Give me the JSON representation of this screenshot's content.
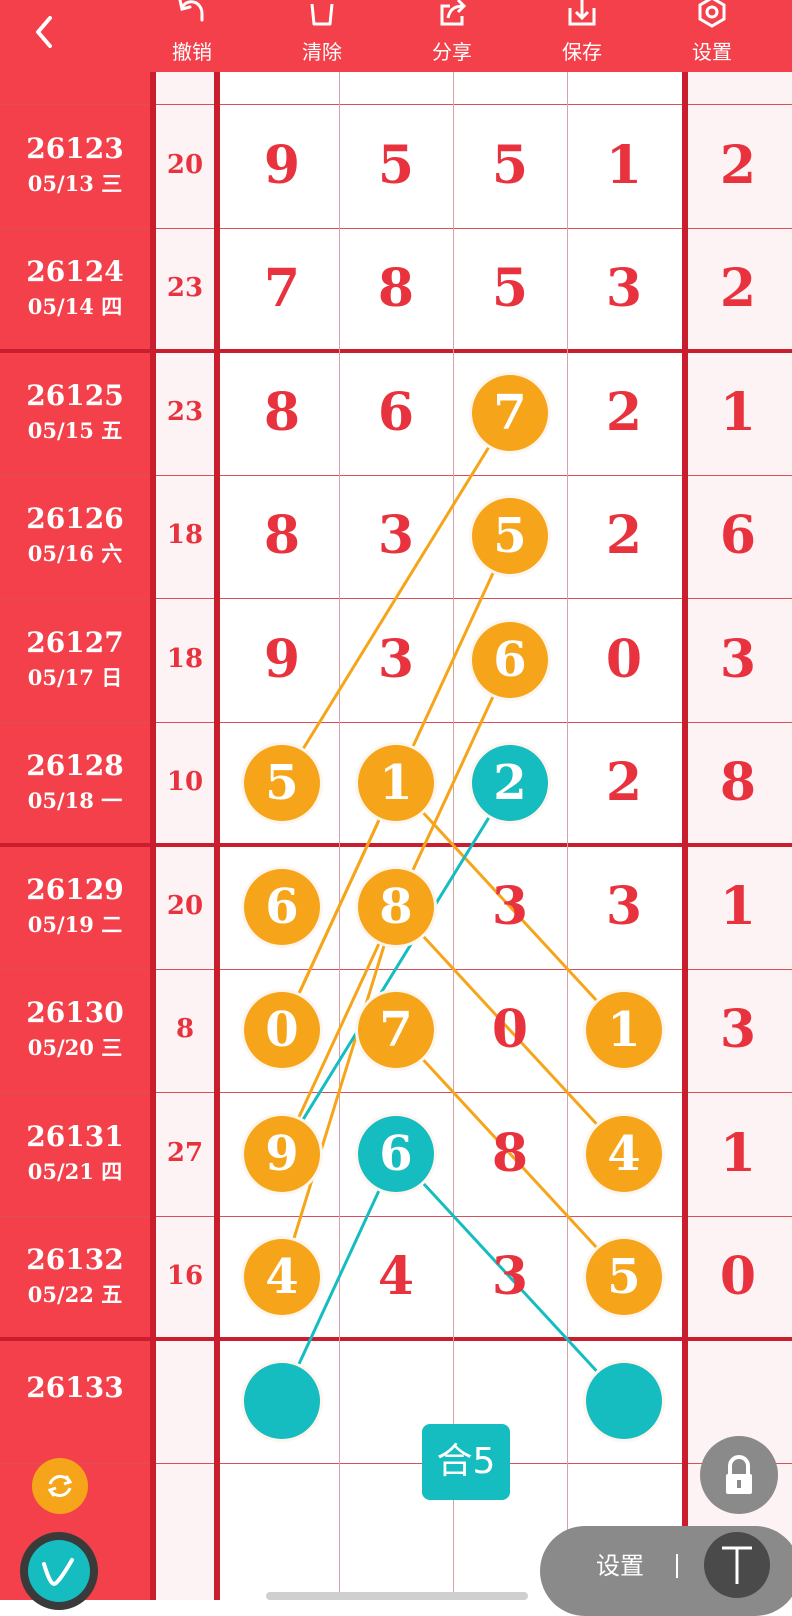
{
  "toolbar": {
    "undo": "撤销",
    "clear": "清除",
    "share": "分享",
    "save": "保存",
    "settings": "设置"
  },
  "rows": [
    {
      "issue": "26123",
      "date": "05/13 三",
      "sum": "20",
      "digits": [
        "9",
        "5",
        "5",
        "1"
      ],
      "span": "2"
    },
    {
      "issue": "26124",
      "date": "05/14 四",
      "sum": "23",
      "digits": [
        "7",
        "8",
        "5",
        "3"
      ],
      "span": "2"
    },
    {
      "issue": "26125",
      "date": "05/15 五",
      "sum": "23",
      "digits": [
        "8",
        "6",
        "7",
        "2"
      ],
      "span": "1"
    },
    {
      "issue": "26126",
      "date": "05/16 六",
      "sum": "18",
      "digits": [
        "8",
        "3",
        "5",
        "2"
      ],
      "span": "6"
    },
    {
      "issue": "26127",
      "date": "05/17 日",
      "sum": "18",
      "digits": [
        "9",
        "3",
        "6",
        "0"
      ],
      "span": "3"
    },
    {
      "issue": "26128",
      "date": "05/18 一",
      "sum": "10",
      "digits": [
        "5",
        "1",
        "2",
        "2"
      ],
      "span": "8"
    },
    {
      "issue": "26129",
      "date": "05/19 二",
      "sum": "20",
      "digits": [
        "6",
        "8",
        "3",
        "3"
      ],
      "span": "1"
    },
    {
      "issue": "26130",
      "date": "05/20 三",
      "sum": "8",
      "digits": [
        "0",
        "7",
        "0",
        "1"
      ],
      "span": "3"
    },
    {
      "issue": "26131",
      "date": "05/21 四",
      "sum": "27",
      "digits": [
        "9",
        "6",
        "8",
        "4"
      ],
      "span": "1"
    },
    {
      "issue": "26132",
      "date": "05/22 五",
      "sum": "16",
      "digits": [
        "4",
        "4",
        "3",
        "5"
      ],
      "span": "0"
    },
    {
      "issue": "26133",
      "date": "",
      "sum": "",
      "digits": [
        "",
        "",
        "",
        ""
      ],
      "span": ""
    }
  ],
  "highlights": [
    {
      "row": 2,
      "col": 2,
      "color": "orange"
    },
    {
      "row": 3,
      "col": 2,
      "color": "orange"
    },
    {
      "row": 4,
      "col": 2,
      "color": "orange"
    },
    {
      "row": 5,
      "col": 0,
      "color": "orange"
    },
    {
      "row": 5,
      "col": 1,
      "color": "orange"
    },
    {
      "row": 5,
      "col": 2,
      "color": "teal"
    },
    {
      "row": 6,
      "col": 0,
      "color": "orange"
    },
    {
      "row": 6,
      "col": 1,
      "color": "orange"
    },
    {
      "row": 7,
      "col": 0,
      "color": "orange"
    },
    {
      "row": 7,
      "col": 1,
      "color": "orange"
    },
    {
      "row": 7,
      "col": 3,
      "color": "orange"
    },
    {
      "row": 8,
      "col": 0,
      "color": "orange"
    },
    {
      "row": 8,
      "col": 1,
      "color": "teal"
    },
    {
      "row": 8,
      "col": 3,
      "color": "orange"
    },
    {
      "row": 9,
      "col": 0,
      "color": "orange"
    },
    {
      "row": 9,
      "col": 3,
      "color": "orange"
    },
    {
      "row": 10,
      "col": 0,
      "color": "teal"
    },
    {
      "row": 10,
      "col": 3,
      "color": "teal"
    }
  ],
  "links": [
    {
      "from": [
        2,
        2
      ],
      "to": [
        5,
        0
      ],
      "color": "orange"
    },
    {
      "from": [
        3,
        2
      ],
      "to": [
        7,
        0
      ],
      "color": "orange"
    },
    {
      "from": [
        4,
        2
      ],
      "to": [
        8,
        0
      ],
      "color": "orange"
    },
    {
      "from": [
        5,
        1
      ],
      "to": [
        7,
        0
      ],
      "color": "orange"
    },
    {
      "from": [
        5,
        1
      ],
      "to": [
        7,
        3
      ],
      "color": "orange"
    },
    {
      "from": [
        6,
        1
      ],
      "to": [
        8,
        3
      ],
      "color": "orange"
    },
    {
      "from": [
        6,
        1
      ],
      "to": [
        9,
        0
      ],
      "color": "orange"
    },
    {
      "from": [
        7,
        1
      ],
      "to": [
        9,
        3
      ],
      "color": "orange"
    },
    {
      "from": [
        5,
        2
      ],
      "to": [
        8,
        0
      ],
      "color": "teal"
    },
    {
      "from": [
        8,
        1
      ],
      "to": [
        10,
        0
      ],
      "color": "teal"
    },
    {
      "from": [
        8,
        1
      ],
      "to": [
        10,
        3
      ],
      "color": "teal"
    }
  ],
  "colors": {
    "orange": "#f6a51a",
    "teal": "#15bcc0",
    "red": "#f3404a"
  },
  "sum_badge": "合5",
  "bottom_bar": {
    "settings": "设置"
  },
  "icons": [
    "back-icon",
    "undo-icon",
    "trash-icon",
    "share-icon",
    "save-icon",
    "settings-icon",
    "lock-icon",
    "refresh-icon",
    "pen-icon",
    "text-tool-icon"
  ]
}
